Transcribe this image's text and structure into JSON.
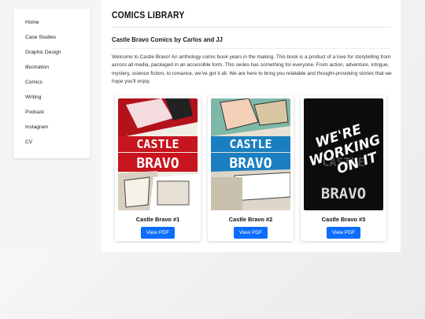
{
  "sidebar": {
    "items": [
      {
        "label": "Home"
      },
      {
        "label": "Case Studies"
      },
      {
        "label": "Graphic Design"
      },
      {
        "label": "Illustration"
      },
      {
        "label": "Comics"
      },
      {
        "label": "Writing"
      },
      {
        "label": "Podcast"
      },
      {
        "label": "Instagram"
      },
      {
        "label": "CV"
      }
    ]
  },
  "main": {
    "title": "COMICS LIBRARY",
    "subtitle": "Castle Bravo Comics by Carlos and JJ",
    "intro": "Welcome to Castle Bravo! An anthology comic book years in the making. This book is a product of a love for storytelling from across all media, packaged in an accessible form. This series has something for everyone. From action, adventure, intrigue, mystery, science fiction, to romance, we've got it all. We are here to bring you relatable and thought-provoking stories that we hope you'll enjoy."
  },
  "comics": [
    {
      "title": "Castle Bravo #1",
      "button": "View PDF",
      "cover_word_top": "CASTLE",
      "cover_word_bottom": "BRAVO",
      "accent": "#c8141e"
    },
    {
      "title": "Castle Bravo #2",
      "button": "View PDF",
      "cover_word_top": "CASTLE",
      "cover_word_bottom": "BRAVO",
      "accent": "#1a7fc0"
    },
    {
      "title": "Castle Bravo #3",
      "button": "View PDF",
      "cover_word_top": "CASTLE",
      "cover_word_bottom": "BRAVO",
      "overlay_line1": "WE'RE",
      "overlay_line2": "WORKING",
      "overlay_line3": "ON IT",
      "accent": "#111111"
    }
  ]
}
